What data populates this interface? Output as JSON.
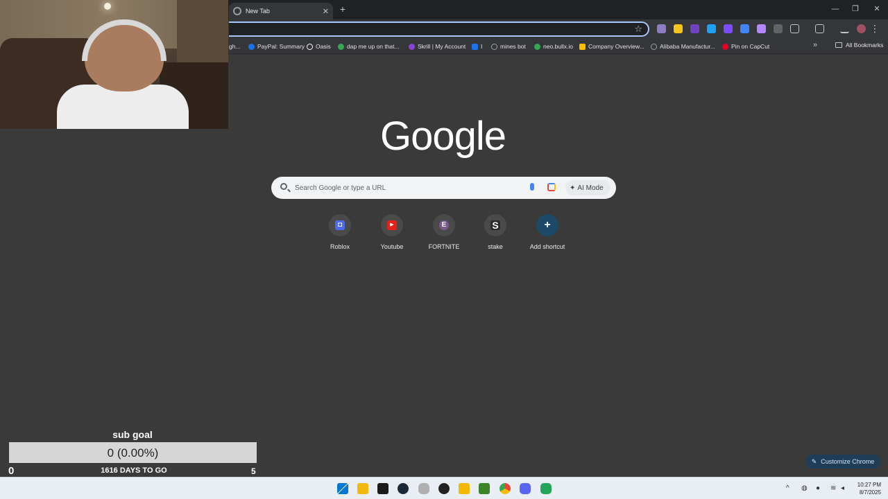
{
  "tab": {
    "title": "New Tab"
  },
  "bookmarks": [
    {
      "label": "gh...",
      "color": "#5f6368"
    },
    {
      "label": "PayPal: Summary",
      "color": "#1a73e8"
    },
    {
      "label": "Oasis",
      "color": "#ffffff"
    },
    {
      "label": "dap me up on that...",
      "color": "#34a853"
    },
    {
      "label": "Skrill | My Account",
      "color": "#8b3fd9"
    },
    {
      "label": "I",
      "color": "#1a73e8"
    },
    {
      "label": "mines bot",
      "color": "#9aa0a6"
    },
    {
      "label": "neo.bullx.io",
      "color": "#34a853"
    },
    {
      "label": "Company Overview...",
      "color": "#fbbc05"
    },
    {
      "label": "Alibaba Manufactur...",
      "color": "#9aa0a6"
    },
    {
      "label": "Pin on CapCut",
      "color": "#e60023"
    }
  ],
  "all_bookmarks": "All Bookmarks",
  "logo": "Google",
  "search": {
    "placeholder": "Search Google or type a URL",
    "ai_mode": "AI Mode"
  },
  "shortcuts": [
    {
      "label": "Roblox",
      "glyph": "◘",
      "color": "#4f6bed"
    },
    {
      "label": "Youtube",
      "glyph": "▶",
      "color": "#e62117"
    },
    {
      "label": "FORTNITE",
      "glyph": "E",
      "color": "#7a5a8a"
    },
    {
      "label": "stake",
      "glyph": "S",
      "color": "#2a2a2a"
    },
    {
      "label": "Add shortcut",
      "glyph": "+",
      "color": "#1c4966"
    }
  ],
  "customize": "Customize Chrome",
  "subgoal": {
    "title": "sub goal",
    "value_text": "0 (0.00%)",
    "progress": 0,
    "min": "0",
    "days": "1616 DAYS TO GO",
    "max": "5"
  },
  "clock": {
    "time": "10:27 PM",
    "date": "8/7/2025"
  }
}
